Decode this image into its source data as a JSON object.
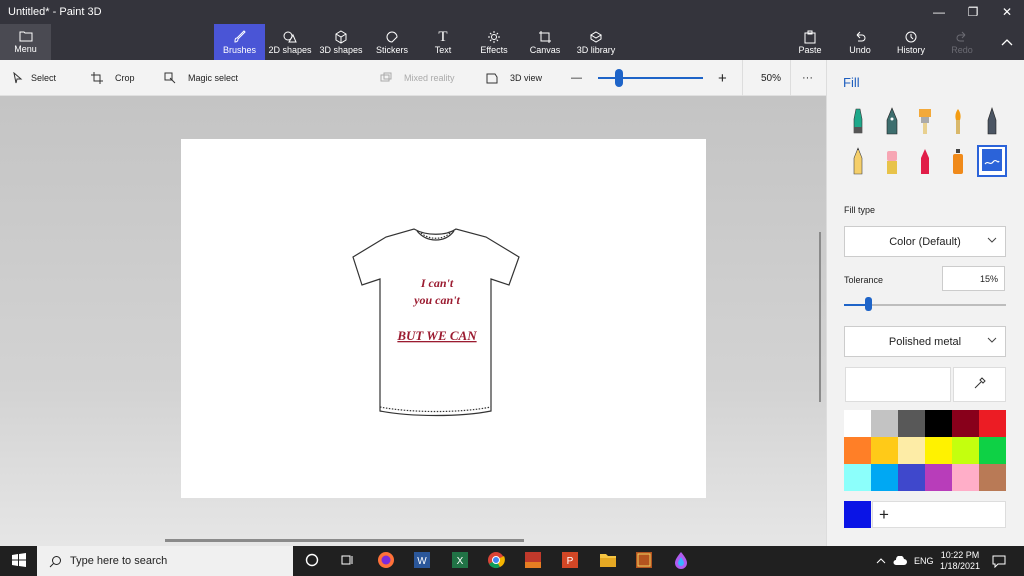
{
  "window": {
    "title": "Untitled* - Paint 3D",
    "minimize": "—",
    "restore": "❐",
    "close": "✕"
  },
  "ribbon": {
    "menu_label": "Menu",
    "tools": [
      {
        "label": "Brushes",
        "icon": "brush-icon",
        "active": true
      },
      {
        "label": "2D shapes",
        "icon": "2d-shapes-icon"
      },
      {
        "label": "3D shapes",
        "icon": "3d-shapes-icon"
      },
      {
        "label": "Stickers",
        "icon": "stickers-icon"
      },
      {
        "label": "Text",
        "icon": "text-icon"
      },
      {
        "label": "Effects",
        "icon": "effects-icon"
      },
      {
        "label": "Canvas",
        "icon": "canvas-icon"
      },
      {
        "label": "3D library",
        "icon": "3d-library-icon"
      }
    ],
    "right_tools": [
      {
        "label": "Paste",
        "icon": "paste-icon"
      },
      {
        "label": "Undo",
        "icon": "undo-icon"
      },
      {
        "label": "History",
        "icon": "history-icon"
      },
      {
        "label": "Redo",
        "icon": "redo-icon",
        "disabled": true
      }
    ]
  },
  "toolbar": {
    "select": "Select",
    "crop": "Crop",
    "magic_select": "Magic select",
    "mixed_reality": "Mixed reality",
    "view_3d": "3D view",
    "zoom_minus": "—",
    "zoom_plus": "+",
    "zoom_value": "50%",
    "zoom_level": 0.2,
    "more": "···"
  },
  "canvas": {
    "shirt_line1": "I can't",
    "shirt_line2": "you can't",
    "shirt_line3": "BUT WE CAN"
  },
  "panel": {
    "title": "Fill",
    "fill_type_label": "Fill type",
    "fill_type_value": "Color (Default)",
    "tolerance_label": "Tolerance",
    "tolerance_value": "15%",
    "tolerance_level": 0.15,
    "material_value": "Polished metal",
    "add_color": "+",
    "current_color": "#0a14e6",
    "palette": [
      "#ffffff",
      "#c3c3c3",
      "#585858",
      "#000000",
      "#88001b",
      "#ec1c24",
      "#ff7f27",
      "#ffca18",
      "#fdeca6",
      "#fff200",
      "#c4ff0e",
      "#0ed145",
      "#8cfffb",
      "#00a8f3",
      "#3f48cc",
      "#b83dba",
      "#ffaec8",
      "#b97a56"
    ],
    "brushes": [
      "marker",
      "calligraphy-pen",
      "oil-brush",
      "watercolor",
      "pixel-pen",
      "pencil",
      "eraser",
      "crayon",
      "spray-can",
      "fill"
    ]
  },
  "taskbar": {
    "search_placeholder": "Type here to search",
    "language": "ENG",
    "time": "10:22 PM",
    "date": "1/18/2021"
  }
}
